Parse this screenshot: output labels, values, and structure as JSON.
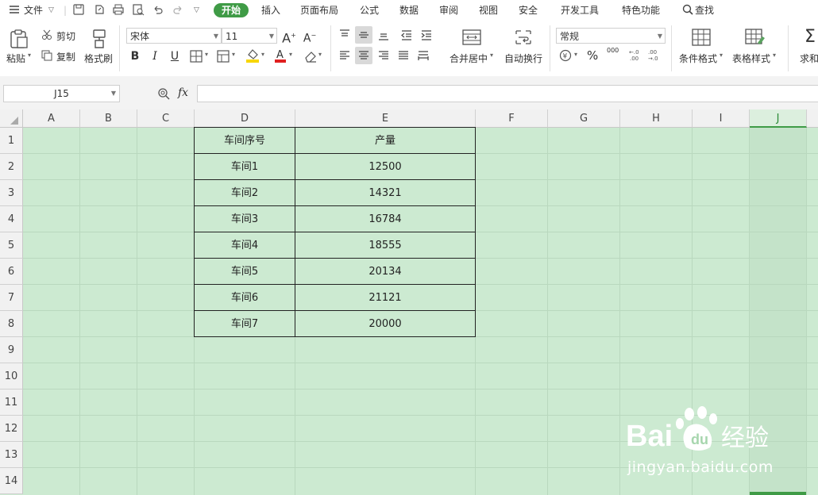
{
  "menu": {
    "file_label": "文件",
    "tabs": [
      "开始",
      "插入",
      "页面布局",
      "公式",
      "数据",
      "审阅",
      "视图",
      "安全",
      "开发工具",
      "特色功能"
    ],
    "active_tab": "开始",
    "search_label": "查找"
  },
  "ribbon": {
    "paste_label": "粘贴",
    "cut_label": "剪切",
    "copy_label": "复制",
    "format_painter_label": "格式刷",
    "font_name": "宋体",
    "font_size": "11",
    "bold": "B",
    "italic": "I",
    "underline": "U",
    "merge_label": "合并居中",
    "wrap_label": "自动换行",
    "number_format": "常规",
    "percent": "%",
    "thousands": "000",
    "cond_format_label": "条件格式",
    "table_style_label": "表格样式",
    "sum_label": "求和"
  },
  "formula_bar": {
    "name_box": "J15",
    "fx": "fx",
    "content": ""
  },
  "columns": [
    "A",
    "B",
    "C",
    "D",
    "E",
    "F",
    "G",
    "H",
    "I",
    "J"
  ],
  "selected_column": "J",
  "rows": [
    "1",
    "2",
    "3",
    "4",
    "5",
    "6",
    "7",
    "8",
    "9",
    "10",
    "11",
    "12",
    "13",
    "14"
  ],
  "table": {
    "headers": [
      "车间序号",
      "产量"
    ],
    "rows": [
      [
        "车间1",
        "12500"
      ],
      [
        "车间2",
        "14321"
      ],
      [
        "车间3",
        "16784"
      ],
      [
        "车间4",
        "18555"
      ],
      [
        "车间5",
        "20134"
      ],
      [
        "车间6",
        "21121"
      ],
      [
        "车间7",
        "20000"
      ]
    ]
  },
  "watermark": {
    "brand": "Bai du 经验",
    "url": "jingyan.baidu.com"
  },
  "colors": {
    "accent": "#3f9b46",
    "sheet_bg": "#ccead1"
  }
}
